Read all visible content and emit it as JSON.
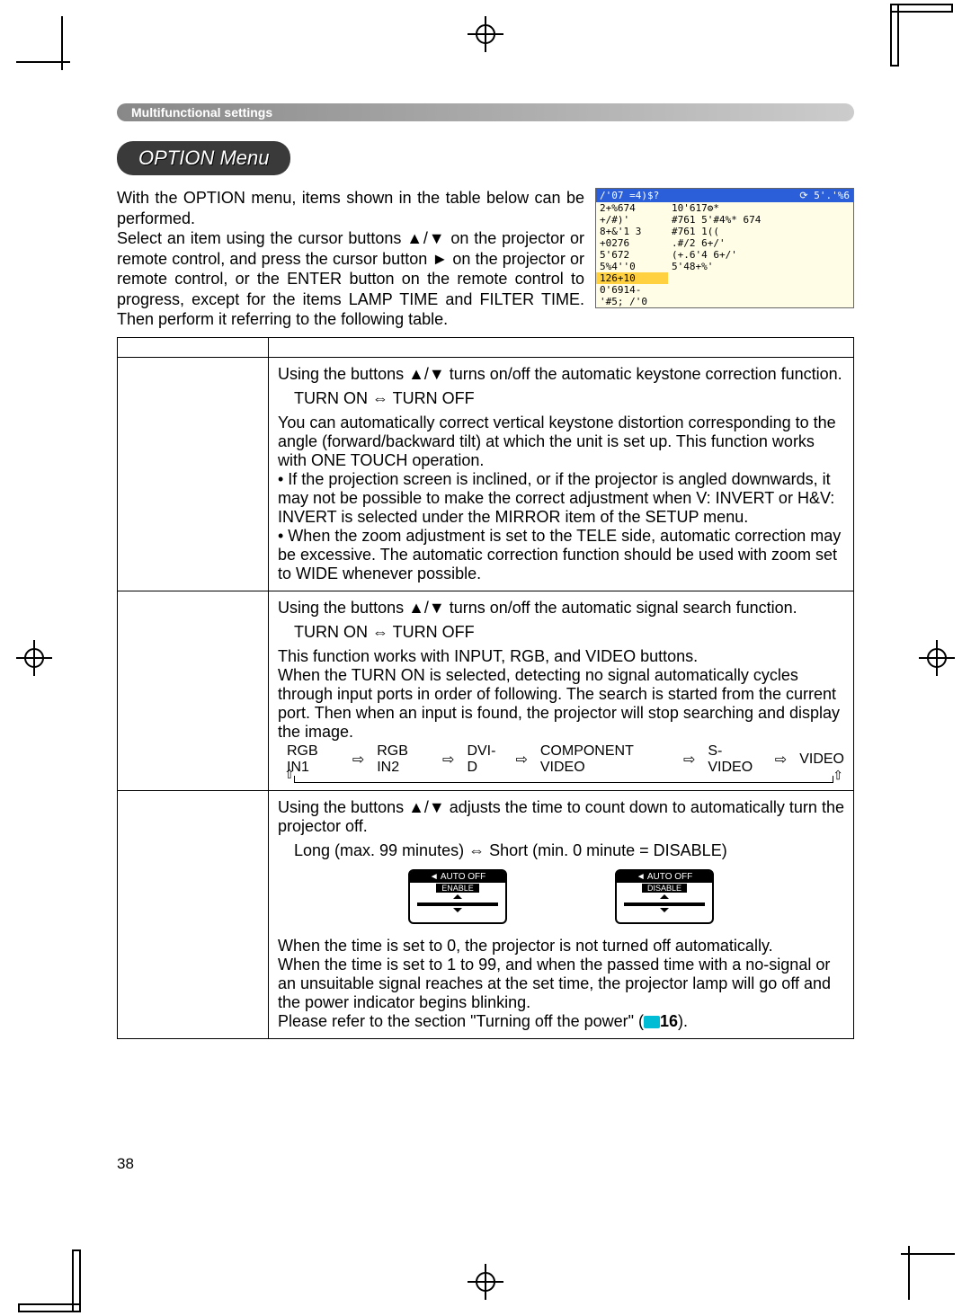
{
  "section_bar": "Multifunctional settings",
  "menu_title": "OPTION Menu",
  "intro": "With the OPTION menu, items shown in the table below can be performed.\nSelect an item using the cursor buttons ▲/▼ on the projector or remote control, and press the cursor button ► on the projector or remote control, or the ENTER button on the remote control to progress, except for the items LAMP TIME and FILTER TIME. Then perform it referring to the following table.",
  "osd": {
    "title_left": "/'07 =4)$?",
    "title_right": "⟳  5'.'%6",
    "rows_left": [
      "2+%674",
      "+/#)'",
      "8+&'1 3",
      "+0276",
      "5'672",
      "5%4''0",
      "126+10",
      "0'6914-",
      "'#5; /'0"
    ],
    "rows_right": [
      "10'617⚙*",
      "#761 5'#4%* 674",
      "#761 1((",
      ".#/2 6+/'",
      "(+.6'4 6+/'",
      "5'48+%'"
    ],
    "highlight_index": 6
  },
  "table": {
    "rows": [
      {
        "body_lines": [
          "Using the buttons ▲/▼ turns on/off the automatic  keystone correction function.",
          "",
          "You can automatically correct vertical keystone distortion corresponding to the angle (forward/backward tilt) at which the unit is set up. This function works with ONE TOUCH operation.",
          "• If the projection screen is inclined, or if the projector is angled downwards, it may not be possible to make the correct adjustment when V: INVERT or H&V: INVERT is selected under the MIRROR item of the SETUP menu.",
          "• When the zoom adjustment is set to the TELE side, automatic correction may be excessive. The automatic correction function should be used with zoom set to WIDE whenever possible."
        ],
        "options": "TURN ON ⇔ TURN OFF"
      },
      {
        "body_lines": [
          "Using the buttons ▲/▼ turns on/off the automatic signal search function.",
          "",
          "This function works with INPUT, RGB, and VIDEO buttons.",
          "When the TURN ON is selected, detecting no signal automatically cycles through input ports in order of following. The search is started from the current port. Then when an input is found, the projector will stop searching and display the image."
        ],
        "options": "TURN ON ⇔ TURN OFF",
        "cycle": [
          "RGB IN1",
          "RGB IN2",
          "DVI-D",
          "COMPONENT VIDEO",
          "S-VIDEO",
          "VIDEO"
        ]
      },
      {
        "body_lines_top": [
          "Using the buttons ▲/▼ adjusts the time to count down to automatically turn the projector off."
        ],
        "options": "Long (max. 99 minutes) ⇔ Short (min. 0 minute = DISABLE)",
        "auto_off": {
          "left_hdr": "◄ AUTO OFF",
          "left_lbl": "ENABLE",
          "right_hdr": "◄ AUTO OFF",
          "right_lbl": "DISABLE"
        },
        "body_lines_bottom": [
          "When the time is set to 0, the projector is not turned off automatically.",
          "When the time is set to 1 to 99, and when the passed time with a no-signal or an unsuitable signal reaches at the set time, the projector lamp will go off and the power indicator begins blinking.",
          "Please refer to the section \"Turning off the power\" ("
        ],
        "ref_num": "16",
        "ref_tail": ")."
      }
    ]
  },
  "page_number": "38"
}
